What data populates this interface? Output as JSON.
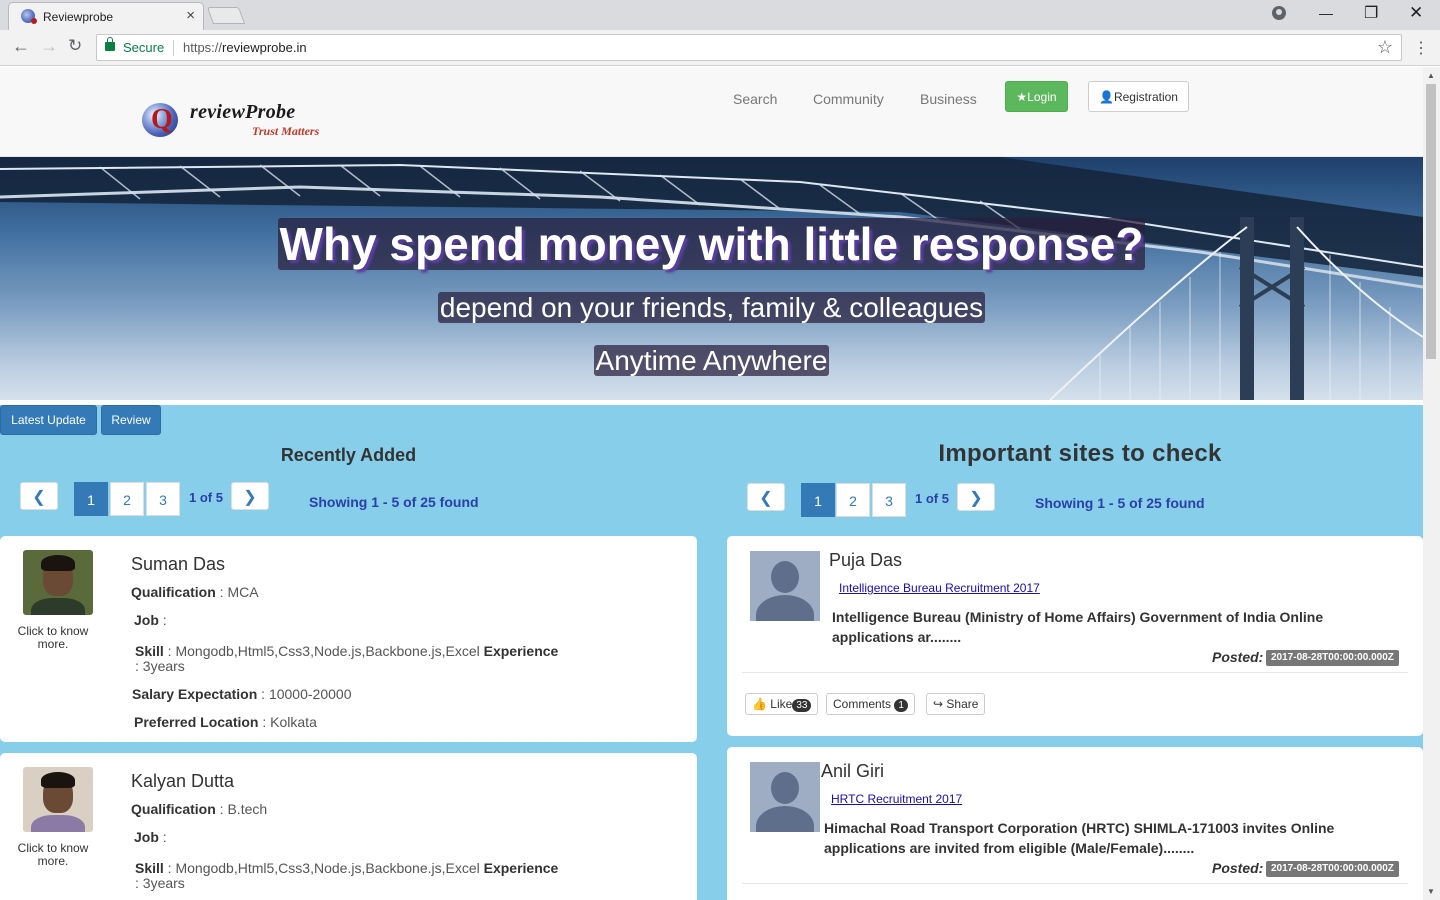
{
  "browser": {
    "tab_title": "Reviewprobe",
    "secure_label": "Secure",
    "url_proto": "https://",
    "url_host": "reviewprobe.in"
  },
  "header": {
    "logo_name": "reviewProbe",
    "logo_tagline": "Trust Matters",
    "nav": [
      "Search",
      "Community",
      "Business"
    ],
    "login_label": "Login",
    "registration_label": "Registration"
  },
  "hero": {
    "title": "Why spend money with little response?",
    "subtitle": "depend on your friends, family & colleagues",
    "tagline": "Anytime Anywhere"
  },
  "tabs": [
    "Latest Update",
    "Review"
  ],
  "recent": {
    "title": "Recently Added",
    "pages": [
      "1",
      "2",
      "3"
    ],
    "page_of": "1 of 5",
    "showing": "Showing 1 - 5 of 25 found",
    "click_text": "Click to know more.",
    "profiles": [
      {
        "name": "Suman Das",
        "qualification_label": "Qualification",
        "qualification": "MCA",
        "job_label": "Job",
        "skill_label": "Skill",
        "skills": "Mongodb,Html5,Css3,Node.js,Backbone.js,Excel",
        "experience_label": "Experience",
        "experience": "3years",
        "salary_label": "Salary Expectation",
        "salary": "10000-20000",
        "location_label": "Preferred Location",
        "location": "Kolkata"
      },
      {
        "name": "Kalyan Dutta",
        "qualification_label": "Qualification",
        "qualification": "B.tech",
        "job_label": "Job",
        "skill_label": "Skill",
        "skills": "Mongodb,Html5,Css3,Node.js,Backbone.js,Excel",
        "experience_label": "Experience",
        "experience": "3years"
      }
    ]
  },
  "important": {
    "title": "Important sites to check",
    "pages": [
      "1",
      "2",
      "3"
    ],
    "page_of": "1 of 5",
    "showing": "Showing 1 - 5 of 25 found",
    "posted_label": "Posted:",
    "items": [
      {
        "name": "Puja Das",
        "link": "Intelligence Bureau Recruitment 2017",
        "desc": "Intelligence Bureau (Ministry of Home Affairs) Government of India Online applications ar........",
        "posted": "2017-08-28T00:00:00.000Z",
        "like_label": "Like",
        "like_count": "33",
        "comments_label": "Comments",
        "comments_count": "1",
        "share_label": "Share"
      },
      {
        "name": "Anil Giri",
        "link": "HRTC Recruitment 2017",
        "desc": "Himachal Road Transport Corporation (HRTC) SHIMLA-171003 invites Online applications are invited from eligible (Male/Female)........",
        "posted": "2017-08-28T00:00:00.000Z"
      }
    ]
  },
  "colors": {
    "content_bg": "#87ceeb",
    "primary": "#337ab7",
    "success": "#5cb85c"
  }
}
